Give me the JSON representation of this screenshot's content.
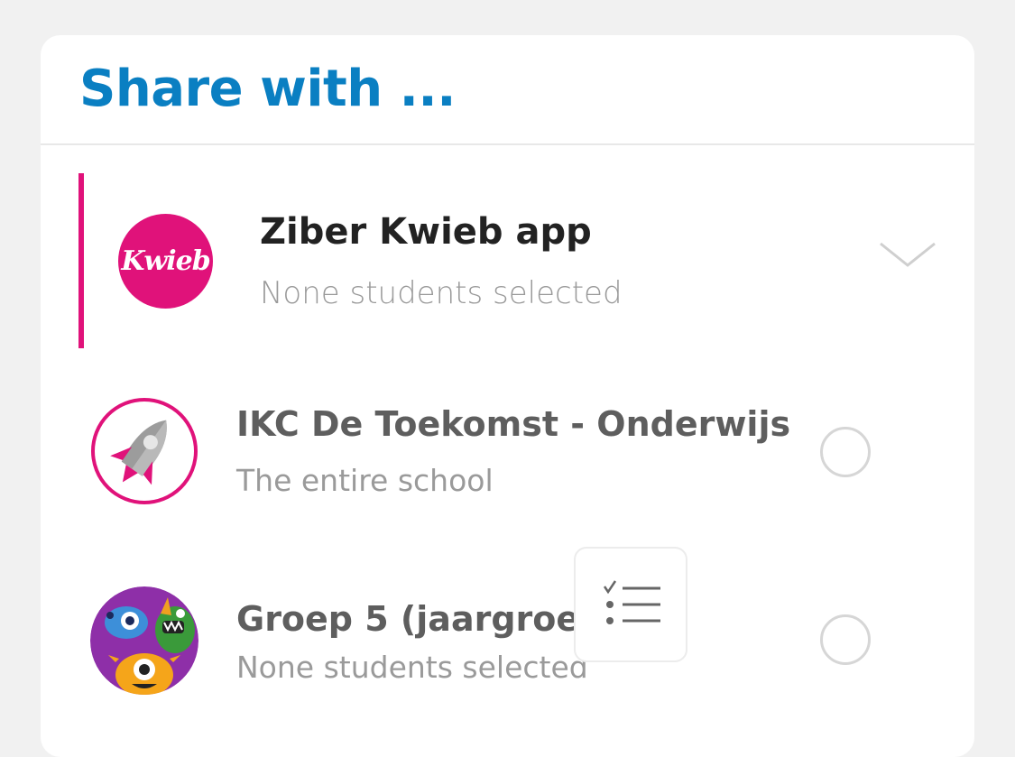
{
  "header": {
    "title": "Share with ..."
  },
  "app": {
    "logo_text": "Kwieb",
    "name": "Ziber Kwieb app",
    "status": "None students selected",
    "accent_color": "#e0127a"
  },
  "groups": [
    {
      "title": "IKC De Toekomst - Onderwijs",
      "subtitle": "The entire school",
      "avatar_icon": "rocket-icon",
      "selected": false
    },
    {
      "title": "Groep 5 (jaargroep: 5)",
      "subtitle": "None students selected",
      "avatar_icon": "monsters-icon",
      "selected": false,
      "action_icon": "checklist-icon"
    }
  ],
  "colors": {
    "title_blue": "#0a7fc2",
    "brand_pink": "#e0127a",
    "text_dark": "#222222",
    "text_grey": "#9a9a9a"
  }
}
